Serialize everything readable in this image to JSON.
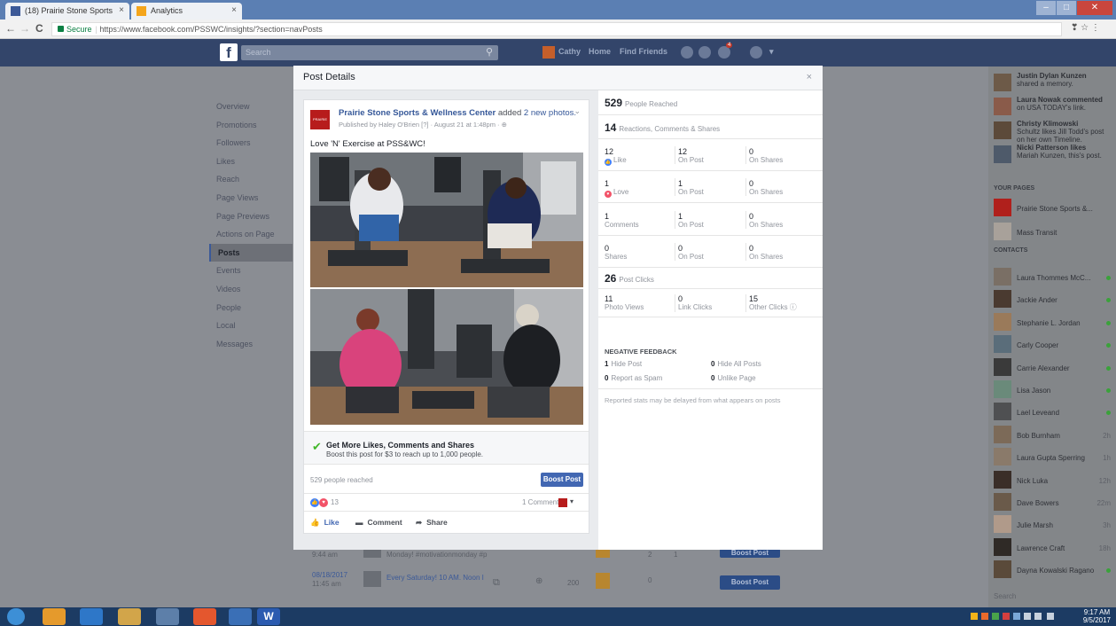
{
  "browser": {
    "tabs": [
      {
        "label": "(18) Prairie Stone Sports",
        "close": "×"
      },
      {
        "label": "Analytics",
        "close": "×"
      }
    ],
    "window_buttons": [
      "–",
      "□",
      "✕"
    ],
    "back": "←",
    "forward": "→",
    "reload": "C",
    "secure_label": "Secure",
    "url": "https://www.facebook.com/PSSWC/insights/?section=navPosts",
    "ext_icons": "❣ ☆ ⋮"
  },
  "fbbar": {
    "logo": "f",
    "search_placeholder": "Search",
    "user": "Cathy",
    "home": "Home",
    "find_friends": "Find Friends",
    "notif_count": "4"
  },
  "left_nav": [
    "Overview",
    "Promotions",
    "Followers",
    "Likes",
    "Reach",
    "Page Views",
    "Page Previews",
    "Actions on Page",
    "Posts",
    "Events",
    "Videos",
    "People",
    "Local",
    "Messages"
  ],
  "left_nav_active": "Posts",
  "chat": {
    "activity": [
      {
        "name": "Justin Dylan Kunzen",
        "sub": "shared a memory."
      },
      {
        "name": "Laura Nowak commented",
        "sub": "on USA TODAY's link."
      },
      {
        "name": "Christy Klimowski",
        "sub": "Schultz likes Jill Todd's post on her own Timeline."
      },
      {
        "name": "Nicki Patterson likes",
        "sub": "Mariah Kunzen, this's post."
      }
    ],
    "your_pages_header": "YOUR PAGES",
    "pages": [
      "Prairie Stone Sports &...",
      "Mass Transit"
    ],
    "contacts_header": "CONTACTS",
    "contacts": [
      {
        "name": "Laura Thommes McC...",
        "time": ""
      },
      {
        "name": "Jackie Ander",
        "time": ""
      },
      {
        "name": "Stephanie L. Jordan",
        "time": ""
      },
      {
        "name": "Carly Cooper",
        "time": ""
      },
      {
        "name": "Carrie Alexander",
        "time": ""
      },
      {
        "name": "Lisa Jason",
        "time": ""
      },
      {
        "name": "Lael Leveand",
        "time": ""
      },
      {
        "name": "Bob Burnham",
        "time": "2h"
      },
      {
        "name": "Laura Gupta Sperring",
        "time": "1h"
      },
      {
        "name": "Nick Luka",
        "time": "12h"
      },
      {
        "name": "Dave Bowers",
        "time": "22m"
      },
      {
        "name": "Julie Marsh",
        "time": "3h"
      },
      {
        "name": "Lawrence Craft",
        "time": "18h"
      },
      {
        "name": "Dayna Kowalski Ragano",
        "time": ""
      }
    ],
    "search_placeholder": "Search"
  },
  "background_rows": [
    {
      "date": "",
      "time": "9:44 am",
      "text": "Monday! #motivationmonday #p",
      "reach": "2",
      "eng": "1",
      "btn": "Boost Post"
    },
    {
      "date": "08/18/2017",
      "time": "11:45 am",
      "text": "Every Saturday! 10 AM. Noon I",
      "reach": "200",
      "eng": "0",
      "btn": "Boost Post"
    }
  ],
  "modal": {
    "title": "Post Details",
    "close": "×",
    "post": {
      "page_name": "Prairie Stone Sports & Wellness Center",
      "action": "added",
      "action_link": "2 new photos.",
      "published": "Published by Haley O'Brien [?] · August 21 at 1:48pm · ⊕",
      "text": "Love 'N' Exercise at PSS&WC!",
      "boost_title": "Get More Likes, Comments and Shares",
      "boost_sub": "Boost this post for $3 to reach up to 1,000 people.",
      "reached": "529 people reached",
      "boost_btn": "Boost Post",
      "reaction_count": "13",
      "comment_count": "1 Comment",
      "like": "Like",
      "comment": "Comment",
      "share": "Share"
    },
    "stats": {
      "people_reached": {
        "value": "529",
        "label": "People Reached"
      },
      "rcs": {
        "value": "14",
        "label": "Reactions, Comments & Shares"
      },
      "rows": [
        {
          "v1": "12",
          "l1": "Like",
          "v2": "12",
          "l2": "On Post",
          "v3": "0",
          "l3": "On Shares"
        },
        {
          "v1": "1",
          "l1": "Love",
          "v2": "1",
          "l2": "On Post",
          "v3": "0",
          "l3": "On Shares"
        },
        {
          "v1": "1",
          "l1": "Comments",
          "v2": "1",
          "l2": "On Post",
          "v3": "0",
          "l3": "On Shares"
        },
        {
          "v1": "0",
          "l1": "Shares",
          "v2": "0",
          "l2": "On Post",
          "v3": "0",
          "l3": "On Shares"
        }
      ],
      "post_clicks": {
        "value": "26",
        "label": "Post Clicks"
      },
      "clicks": [
        {
          "v": "11",
          "l": "Photo Views"
        },
        {
          "v": "0",
          "l": "Link Clicks"
        },
        {
          "v": "15",
          "l": "Other Clicks"
        }
      ],
      "negative_title": "NEGATIVE FEEDBACK",
      "negative": [
        {
          "v": "1",
          "l": "Hide Post"
        },
        {
          "v": "0",
          "l": "Hide All Posts"
        },
        {
          "v": "0",
          "l": "Report as Spam"
        },
        {
          "v": "0",
          "l": "Unlike Page"
        }
      ],
      "delay_note": "Reported stats may be delayed from what appears on posts"
    }
  },
  "taskbar": {
    "time": "9:17 AM",
    "date": "9/5/2017"
  },
  "colors": {
    "fb_blue": "#4267b2",
    "fb_bar": "#33456a",
    "like_blue": "#4080ff",
    "love_red": "#f25268",
    "check_green": "#42b72a"
  }
}
